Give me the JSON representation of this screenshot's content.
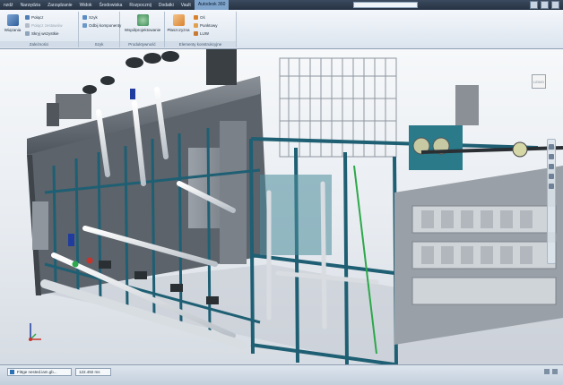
{
  "menu": {
    "items": [
      "nzdź",
      "Narzędzia",
      "Zarządzanie",
      "Widok",
      "Środowiska",
      "Rozpocznij",
      "Dodatki",
      "Vault",
      "Autodesk 360"
    ],
    "active_index": 8
  },
  "ribbon": {
    "panels": [
      {
        "title": "Zależności",
        "big_button": "Wiązania",
        "small_buttons": [
          "Połącz",
          "Połącz zestawów",
          "Skryj wszystkie"
        ]
      },
      {
        "title": "Szyk",
        "small_buttons": [
          "Szyk",
          "Odbij komponenty"
        ]
      },
      {
        "title": "Produktywność",
        "big_button": "Współprojektowanie"
      },
      {
        "title": "Elementy konstrukcyjne",
        "big_button": "Płaszczyzna",
        "small_buttons": [
          "Oś",
          "Punktowy",
          "LUW"
        ]
      }
    ]
  },
  "viewport": {
    "viewcube_label": "LEWO",
    "background_top": "#f6f8fa",
    "frame_color": "#1f5f73",
    "housing_color": "#6c737b",
    "pipe_color": "#e6e9ec",
    "accent_blue": "#1f3c9e",
    "accent_green": "#2da84a",
    "accent_red": "#c7342c"
  },
  "statusbar": {
    "document_tab": "Fittge nested.iam.gb...",
    "zoom_value": "122.492 ms"
  }
}
